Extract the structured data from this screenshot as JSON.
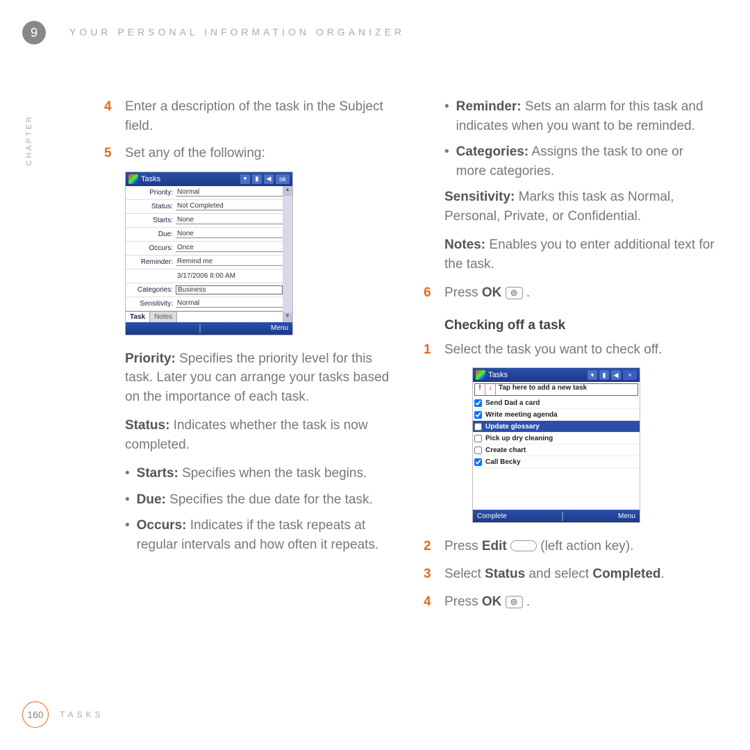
{
  "header": {
    "chapter_number": "9",
    "title": "YOUR PERSONAL INFORMATION ORGANIZER",
    "vertical_label": "CHAPTER"
  },
  "left_column": {
    "step4_num": "4",
    "step4_text": "Enter a description of the task in the Subject field.",
    "step5_num": "5",
    "step5_text": "Set any of the following:",
    "priority_label": "Priority:",
    "priority_text": " Specifies the priority level for this task. Later you can arrange your tasks based on the importance of each task.",
    "status_label": "Status:",
    "status_text": " Indicates whether the task is now completed.",
    "bullets": {
      "starts_label": "Starts:",
      "starts_text": " Specifies when the task begins.",
      "due_label": "Due:",
      "due_text": " Specifies the due date for the task.",
      "occurs_label": "Occurs:",
      "occurs_text": " Indicates if the task repeats at regular intervals and how often it repeats."
    }
  },
  "right_column": {
    "bullets": {
      "reminder_label": "Reminder:",
      "reminder_text": " Sets an alarm for this task and indicates when you want to be reminded.",
      "categories_label": "Categories:",
      "categories_text": " Assigns the task to one or more categories."
    },
    "sensitivity_label": "Sensitivity:",
    "sensitivity_text": " Marks this task as Normal, Personal, Private, or Confidential.",
    "notes_label": "Notes:",
    "notes_text": " Enables you to enter additional text for the task.",
    "step6_num": "6",
    "step6_pre": "Press ",
    "step6_bold": "OK",
    "subhead": "Checking off a task",
    "step1_num": "1",
    "step1_text": "Select the task you want to check off.",
    "step2_num": "2",
    "step2_pre": "Press ",
    "step2_bold": "Edit",
    "step2_post": " (left action key).",
    "step3_num": "3",
    "step3_a": "Select ",
    "step3_b": "Status",
    "step3_c": " and select ",
    "step3_d": "Completed",
    "step3_e": ".",
    "step4b_num": "4",
    "step4b_pre": "Press ",
    "step4b_bold": "OK",
    "step4b_post": " ."
  },
  "screenshot1": {
    "title": "Tasks",
    "ok": "ok",
    "rows": {
      "priority_l": "Priority:",
      "priority_v": "Normal",
      "status_l": "Status:",
      "status_v": "Not Completed",
      "starts_l": "Starts:",
      "starts_v": "None",
      "due_l": "Due:",
      "due_v": "None",
      "occurs_l": "Occurs:",
      "occurs_v": "Once",
      "reminder_l": "Reminder:",
      "reminder_v": "Remind me",
      "reminder2_v": "3/17/2006   8:00 AM",
      "categories_l": "Categories:",
      "categories_v": "Business",
      "sensitivity_l": "Sensitivity:",
      "sensitivity_v": "Normal"
    },
    "tab1": "Task",
    "tab2": "Notes",
    "menu": "Menu"
  },
  "screenshot2": {
    "title": "Tasks",
    "add_placeholder": "Tap here to add a new task",
    "close": "×",
    "tasks": [
      {
        "checked": true,
        "text": "Send Dad a card"
      },
      {
        "checked": true,
        "text": "Write meeting agenda"
      },
      {
        "checked": false,
        "text": "Update glossary",
        "selected": true
      },
      {
        "checked": false,
        "text": "Pick up dry cleaning"
      },
      {
        "checked": false,
        "text": "Create chart"
      },
      {
        "checked": true,
        "text": "Call Becky"
      }
    ],
    "soft_left": "Complete",
    "soft_right": "Menu"
  },
  "footer": {
    "page": "160",
    "section": "TASKS"
  }
}
